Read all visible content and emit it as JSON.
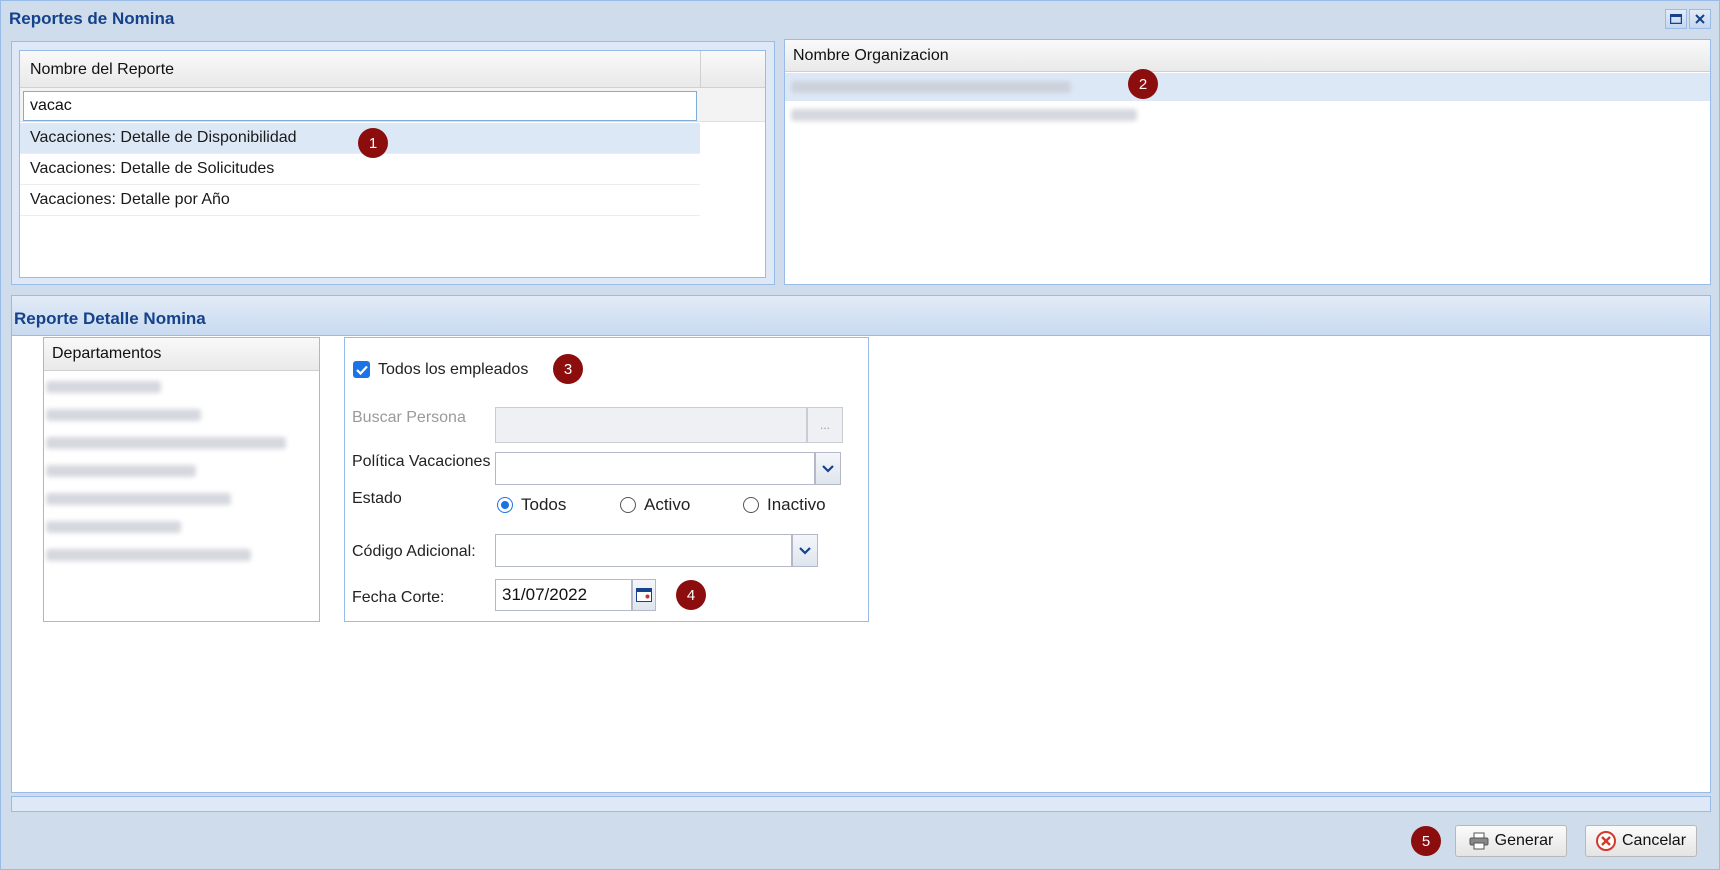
{
  "window": {
    "title": "Reportes de Nomina"
  },
  "report_list": {
    "column_header": "Nombre del Reporte",
    "filter_value": "vacac",
    "rows": [
      "Vacaciones: Detalle de Disponibilidad",
      "Vacaciones: Detalle de Solicitudes",
      "Vacaciones: Detalle por Año"
    ],
    "selected_index": 0
  },
  "org_list": {
    "column_header": "Nombre Organizacion"
  },
  "detail": {
    "title": "Reporte Detalle Nomina",
    "departments_header": "Departamentos",
    "all_employees_label": "Todos los empleados",
    "all_employees_checked": true,
    "search_person_label": "Buscar Persona",
    "search_person_button": "...",
    "policy_label": "Política Vacaciones",
    "status_label": "Estado",
    "status_options": [
      "Todos",
      "Activo",
      "Inactivo"
    ],
    "status_selected": "Todos",
    "code_label": "Código Adicional:",
    "date_label": "Fecha Corte:",
    "date_value": "31/07/2022"
  },
  "footer": {
    "generate_label": "Generar",
    "cancel_label": "Cancelar"
  },
  "badges": [
    "1",
    "2",
    "3",
    "4",
    "5"
  ],
  "colors": {
    "title": "#15428b",
    "badge": "#8b0d0d",
    "selection": "#dde8f7",
    "accent": "#1a73e8"
  }
}
